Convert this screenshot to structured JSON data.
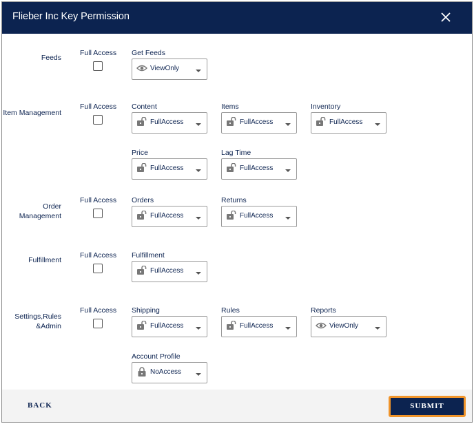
{
  "dialog": {
    "title": "Flieber Inc Key Permission",
    "close_icon": "close-icon"
  },
  "full_access_label": "Full Access",
  "sections": [
    {
      "id": "feeds",
      "label": "Feeds",
      "full_access_checked": false,
      "fields": [
        {
          "label": "Get Feeds",
          "value": "ViewOnly",
          "icon": "eye-icon"
        }
      ]
    },
    {
      "id": "item-management",
      "label": "Item Management",
      "full_access_checked": false,
      "fields": [
        {
          "label": "Content",
          "value": "FullAccess",
          "icon": "unlocked-icon"
        },
        {
          "label": "Items",
          "value": "FullAccess",
          "icon": "unlocked-icon"
        },
        {
          "label": "Inventory",
          "value": "FullAccess",
          "icon": "unlocked-icon"
        },
        {
          "label": "Price",
          "value": "FullAccess",
          "icon": "unlocked-icon"
        },
        {
          "label": "Lag Time",
          "value": "FullAccess",
          "icon": "unlocked-icon"
        }
      ]
    },
    {
      "id": "order-management",
      "label": "Order Management",
      "full_access_checked": false,
      "fields": [
        {
          "label": "Orders",
          "value": "FullAccess",
          "icon": "unlocked-icon"
        },
        {
          "label": "Returns",
          "value": "FullAccess",
          "icon": "unlocked-icon"
        }
      ]
    },
    {
      "id": "fulfillment",
      "label": "Fulfillment",
      "full_access_checked": false,
      "fields": [
        {
          "label": "Fulfillment",
          "value": "FullAccess",
          "icon": "unlocked-icon"
        }
      ]
    },
    {
      "id": "settings-rules-admin",
      "label": "Settings,Rules &Admin",
      "full_access_checked": false,
      "fields": [
        {
          "label": "Shipping",
          "value": "FullAccess",
          "icon": "unlocked-icon"
        },
        {
          "label": "Rules",
          "value": "FullAccess",
          "icon": "unlocked-icon"
        },
        {
          "label": "Reports",
          "value": "ViewOnly",
          "icon": "eye-icon"
        },
        {
          "label": "Account Profile",
          "value": "NoAccess",
          "icon": "locked-icon"
        }
      ]
    }
  ],
  "footer": {
    "back_label": "BACK",
    "submit_label": "SUBMIT"
  },
  "colors": {
    "primary": "#0c2350",
    "focus_outline": "#f0942a",
    "footer_bg": "#f3f3f3"
  }
}
